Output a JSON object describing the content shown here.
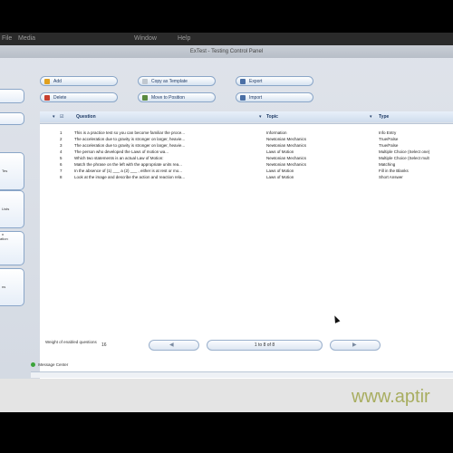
{
  "topbar": {
    "item1": "File",
    "item2": "Media",
    "item3": "Window",
    "item4": "Help"
  },
  "window": {
    "title": "ExTest - Testing Control Panel"
  },
  "sidebar": {
    "items": [
      "",
      "",
      "Tes",
      "Lists",
      "n\nation",
      "ns"
    ]
  },
  "toolbar": {
    "add": "Add",
    "copy_template": "Copy as Template",
    "export": "Export",
    "delete": "Delete",
    "move_position": "Move to Position",
    "import": "Import"
  },
  "table": {
    "headers": {
      "question": "Question",
      "topic": "Topic",
      "type": "Type"
    },
    "rows": [
      {
        "num": "1",
        "question": "This is a practice test so you can become familiar the proce...",
        "topic": "Information",
        "type": "Info Entry"
      },
      {
        "num": "2",
        "question": "The acceleration due to gravity is stronger on larger, heavie...",
        "topic": "Newtonian Mechanics",
        "type": "True/False"
      },
      {
        "num": "3",
        "question": "The acceleration due to gravity is stronger on larger, heavie...",
        "topic": "Newtonian Mechanics",
        "type": "True/False"
      },
      {
        "num": "4",
        "question": "The person who developed the Laws of motion wa...",
        "topic": "Laws of Motion",
        "type": "Multiple Choice (Select one)"
      },
      {
        "num": "5",
        "question": "Which two statements is an actual Law of Motion:",
        "topic": "Newtonian Mechanics",
        "type": "Multiple Choice (Select mult"
      },
      {
        "num": "6",
        "question": "Match the phrase on the left with the appropriate units rea...",
        "topic": "Newtonian Mechanics",
        "type": "Matching"
      },
      {
        "num": "7",
        "question": "In the absence of (1) ___ a (2) ___ , either is at rest or mo...",
        "topic": "Laws of Motion",
        "type": "Fill in the Blanks"
      },
      {
        "num": "8",
        "question": "Look at the image and describe the action and reaction rela...",
        "topic": "Laws of Motion",
        "type": "Short Answer"
      }
    ]
  },
  "footer": {
    "weight_label": "Weight of enabled questions",
    "weight_value": "16",
    "page_status": "1 to 8 of 8",
    "message_center": "Message Center"
  },
  "watermark": "www.aptir",
  "colors": {
    "accent": "#1f3b66",
    "status_dot": "#3aa33a"
  }
}
